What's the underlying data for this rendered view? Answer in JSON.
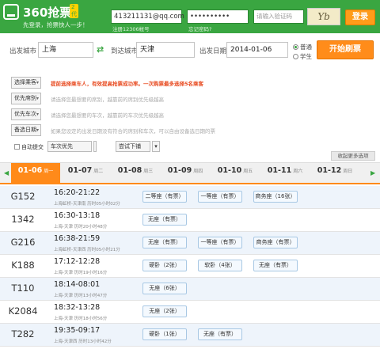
{
  "header": {
    "logo_title": "360抢票",
    "logo_badge": "2代",
    "logo_slogan": "先登录，抢票快人一步！",
    "account_value": "413211131@qq.com",
    "account_note": "注册12306帐号",
    "password_value": "••••••••••",
    "password_note": "忘记密码?",
    "captcha_placeholder": "请输入验证码",
    "captcha_text": "Yb",
    "login_label": "登录"
  },
  "search": {
    "from_label": "出发城市",
    "from_value": "上海",
    "to_label": "到达城市",
    "to_value": "天津",
    "date_label": "出发日期",
    "date_value": "2014-01-06",
    "radio_normal": "普通",
    "radio_student": "学生",
    "start_label": "开始刷票"
  },
  "options": [
    {
      "button": "选择乘客",
      "hint": "提前选择乘车人，有效提高抢票成功率。一次购票最多选择5名乘客"
    },
    {
      "button": "优先席别",
      "hint": "请选择您最想要的席别，越靠前的席别优先级越高"
    },
    {
      "button": "优先车次",
      "hint": "请选择您最想要的车次，越靠前的车次优先级越高"
    },
    {
      "button": "备选日期",
      "hint": "如果您设定的出发日期没有符合的席别和车次，可以自由设备选日期的票"
    }
  ],
  "controls": {
    "auto_submit": "自动提交",
    "train_priority": "车次优先",
    "try_order": "尝试下铺",
    "collapse": "收起更多选项"
  },
  "dates": [
    {
      "date": "01-06",
      "weekday": "周一"
    },
    {
      "date": "01-07",
      "weekday": "周二"
    },
    {
      "date": "01-08",
      "weekday": "周三"
    },
    {
      "date": "01-09",
      "weekday": "周四"
    },
    {
      "date": "01-10",
      "weekday": "周五"
    },
    {
      "date": "01-11",
      "weekday": "周六"
    },
    {
      "date": "01-12",
      "weekday": "周日"
    }
  ],
  "trains": [
    {
      "no": "G152",
      "time": "16:20-21:22",
      "route": "上海虹桥-天津南 历时05小时02分",
      "seats": [
        "二等座（有票）",
        "一等座（有票）",
        "商务座（16张）"
      ]
    },
    {
      "no": "1342",
      "time": "16:30-13:18",
      "route": "上海-天津 历时20小时48分",
      "seats": [
        "无座（有票）"
      ]
    },
    {
      "no": "G216",
      "time": "16:38-21:59",
      "route": "上海虹桥-天津西 历时05小时21分",
      "seats": [
        "无座（有票）",
        "一等座（有票）",
        "商务座（有票）"
      ]
    },
    {
      "no": "K188",
      "time": "17:12-12:28",
      "route": "上海-天津 历时19小时16分",
      "seats": [
        "硬卧（2张）",
        "软卧（4张）",
        "无座（有票）"
      ]
    },
    {
      "no": "T110",
      "time": "18:14-08:01",
      "route": "上海-天津 历时13小时47分",
      "seats": [
        "无座（6张）"
      ]
    },
    {
      "no": "K2084",
      "time": "18:32-13:28",
      "route": "上海-天津 历时18小时56分",
      "seats": [
        "无座（2张）"
      ]
    },
    {
      "no": "T282",
      "time": "19:35-09:17",
      "route": "上海-天津西 历时13小时42分",
      "seats": [
        "硬卧（1张）",
        "无座（有票）"
      ]
    }
  ]
}
